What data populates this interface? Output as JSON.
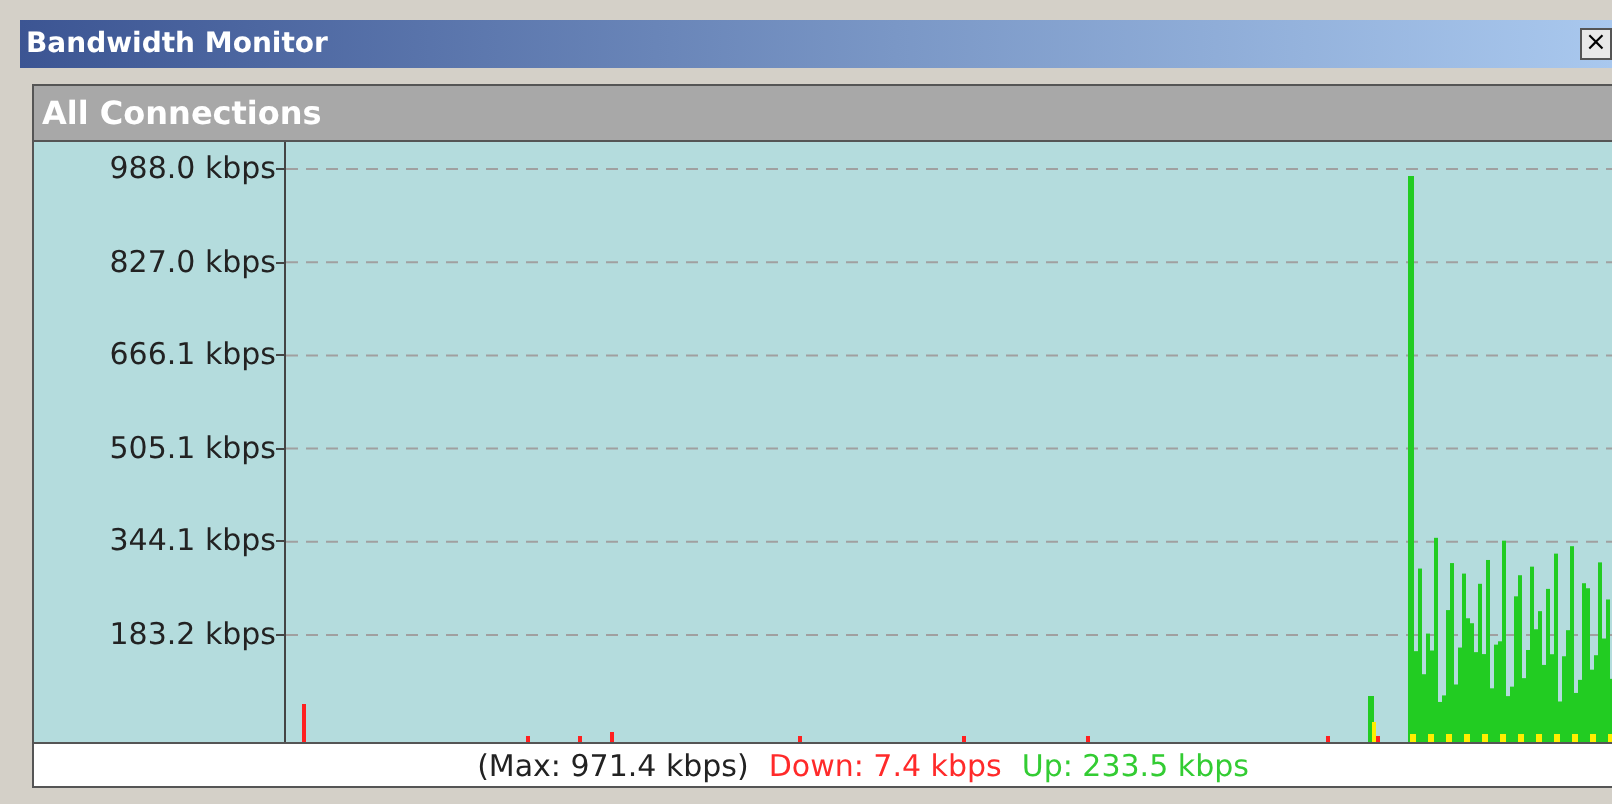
{
  "window": {
    "title": "Bandwidth Monitor",
    "close_glyph": "×"
  },
  "panel": {
    "title": "All Connections",
    "y_labels": [
      "988.0 kbps",
      "827.0 kbps",
      "666.1 kbps",
      "505.1 kbps",
      "344.1 kbps",
      "183.2 kbps"
    ]
  },
  "status": [
    {
      "kind": "max",
      "text": "(Max: 971.4 kbps)"
    },
    {
      "kind": "down",
      "text": "Down: 7.4 kbps"
    },
    {
      "kind": "up",
      "text": "Up: 233.5 kbps"
    }
  ]
}
